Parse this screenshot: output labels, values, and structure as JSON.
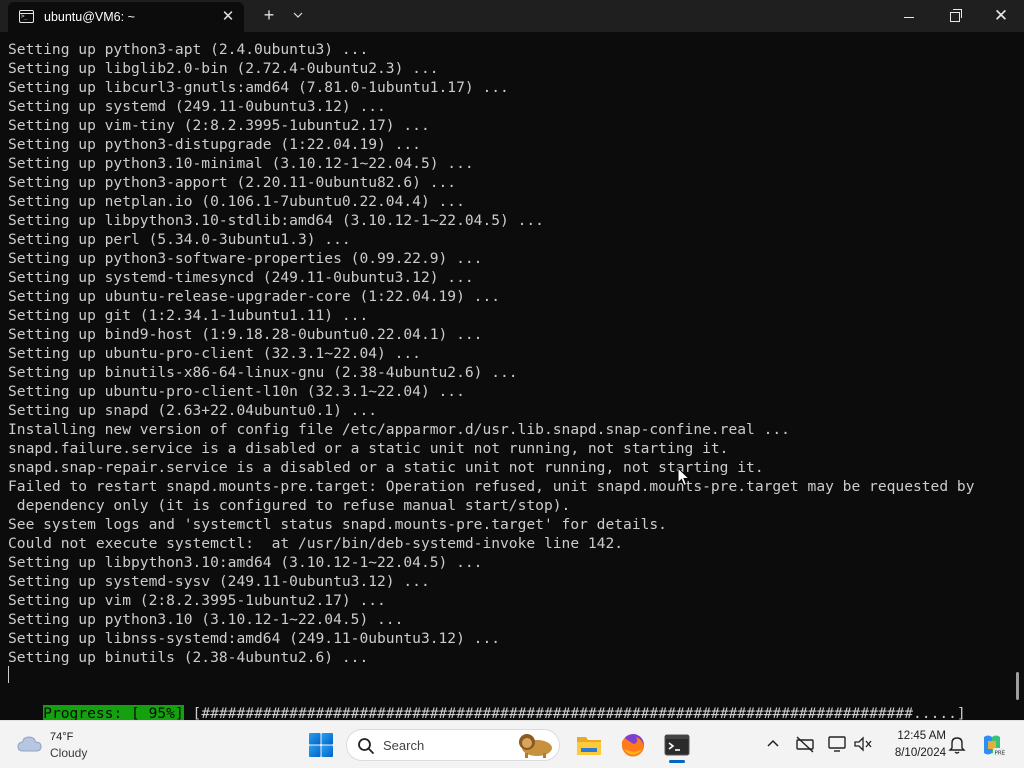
{
  "window": {
    "tab_title": "ubuntu@VM6: ~",
    "tab_close": "✕",
    "new_tab": "+",
    "tab_dropdown": "⌄",
    "close_glyph": "✕"
  },
  "terminal": {
    "lines": [
      "Setting up python3-apt (2.4.0ubuntu3) ...",
      "Setting up libglib2.0-bin (2.72.4-0ubuntu2.3) ...",
      "Setting up libcurl3-gnutls:amd64 (7.81.0-1ubuntu1.17) ...",
      "Setting up systemd (249.11-0ubuntu3.12) ...",
      "Setting up vim-tiny (2:8.2.3995-1ubuntu2.17) ...",
      "Setting up python3-distupgrade (1:22.04.19) ...",
      "Setting up python3.10-minimal (3.10.12-1~22.04.5) ...",
      "Setting up python3-apport (2.20.11-0ubuntu82.6) ...",
      "Setting up netplan.io (0.106.1-7ubuntu0.22.04.4) ...",
      "Setting up libpython3.10-stdlib:amd64 (3.10.12-1~22.04.5) ...",
      "Setting up perl (5.34.0-3ubuntu1.3) ...",
      "Setting up python3-software-properties (0.99.22.9) ...",
      "Setting up systemd-timesyncd (249.11-0ubuntu3.12) ...",
      "Setting up ubuntu-release-upgrader-core (1:22.04.19) ...",
      "Setting up git (1:2.34.1-1ubuntu1.11) ...",
      "Setting up bind9-host (1:9.18.28-0ubuntu0.22.04.1) ...",
      "Setting up ubuntu-pro-client (32.3.1~22.04) ...",
      "Setting up binutils-x86-64-linux-gnu (2.38-4ubuntu2.6) ...",
      "Setting up ubuntu-pro-client-l10n (32.3.1~22.04) ...",
      "Setting up snapd (2.63+22.04ubuntu0.1) ...",
      "Installing new version of config file /etc/apparmor.d/usr.lib.snapd.snap-confine.real ...",
      "snapd.failure.service is a disabled or a static unit not running, not starting it.",
      "snapd.snap-repair.service is a disabled or a static unit not running, not starting it.",
      "Failed to restart snapd.mounts-pre.target: Operation refused, unit snapd.mounts-pre.target may be requested by",
      " dependency only (it is configured to refuse manual start/stop).",
      "See system logs and 'systemctl status snapd.mounts-pre.target' for details.",
      "Could not execute systemctl:  at /usr/bin/deb-systemd-invoke line 142.",
      "Setting up libpython3.10:amd64 (3.10.12-1~22.04.5) ...",
      "Setting up systemd-sysv (249.11-0ubuntu3.12) ...",
      "Setting up vim (2:8.2.3995-1ubuntu2.17) ...",
      "Setting up python3.10 (3.10.12-1~22.04.5) ...",
      "Setting up libnss-systemd:amd64 (249.11-0ubuntu3.12) ...",
      "Setting up binutils (2.38-4ubuntu2.6) ..."
    ],
    "progress_label": "Progress: [ 95%]",
    "progress_bar": " [#################################################################################.....]",
    "progress_percent": 95
  },
  "taskbar": {
    "weather_temp": "74°F",
    "weather_condition": "Cloudy",
    "search_placeholder": "Search",
    "clock_time": "12:45 AM",
    "clock_date": "8/10/2024",
    "tray_chevron": "^",
    "accent_color": "#0067c0"
  },
  "colors": {
    "terminal_bg": "#0c0c0c",
    "terminal_fg": "#cccccc",
    "progress_green": "#13a10e"
  }
}
